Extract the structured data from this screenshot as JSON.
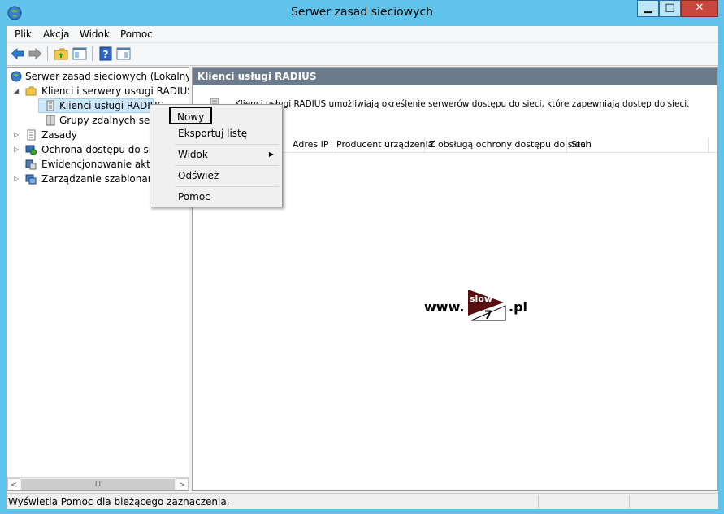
{
  "window": {
    "title": "Serwer zasad sieciowych"
  },
  "menubar": [
    "Plik",
    "Akcja",
    "Widok",
    "Pomoc"
  ],
  "tree": [
    {
      "label": "Serwer zasad sieciowych (Lokalny)",
      "icon": "server-icon"
    },
    {
      "label": "Klienci i serwery usługi RADIUS",
      "icon": "folder-icon"
    },
    {
      "label": "Klienci usługi RADIUS",
      "icon": "document-icon",
      "selected": true
    },
    {
      "label": "Grupy zdalnych serwe",
      "icon": "server-group-icon"
    },
    {
      "label": "Zasady",
      "icon": "policy-icon"
    },
    {
      "label": "Ochrona dostępu do siec",
      "icon": "shield-icon"
    },
    {
      "label": "Ewidencjonowanie aktyw",
      "icon": "accounting-icon"
    },
    {
      "label": "Zarządzanie szablonami",
      "icon": "templates-icon"
    }
  ],
  "right": {
    "header": "Klienci usługi RADIUS",
    "description": "Klienci usługi RADIUS umożliwiają określenie serwerów dostępu do sieci, które zapewniają dostęp do sieci.",
    "columns": [
      "Adres IP",
      "Producent urządzenia",
      "Z obsługą ochrony dostępu do sieci",
      "Stan"
    ]
  },
  "context_menu": [
    "Nowy",
    "Eksportuj listę",
    "Widok",
    "Odśwież",
    "Pomoc"
  ],
  "status": "Wyświetla Pomoc dla bieżącego zaznaczenia.",
  "watermark": {
    "prefix": "www.",
    "logo_top": "slow",
    "logo_num": "7",
    "suffix": ".pl"
  },
  "scroll": {
    "thumb": "III",
    "left": "<",
    "right": ">"
  },
  "colors": {
    "titlebar": "#5fc3ec",
    "header": "#6b7b8c",
    "selection": "#cce8ff"
  }
}
